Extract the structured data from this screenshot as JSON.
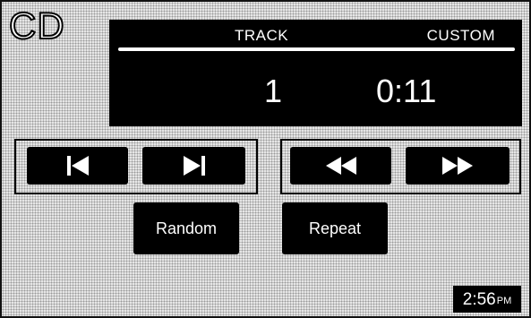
{
  "source": {
    "label": "CD"
  },
  "display": {
    "track_header": "TRACK",
    "mode_header": "CUSTOM",
    "track_number": "1",
    "elapsed_time": "0:11"
  },
  "controls": {
    "previous_track_icon": "skip-previous-icon",
    "next_track_icon": "skip-next-icon",
    "rewind_icon": "rewind-icon",
    "fast_forward_icon": "fast-forward-icon",
    "random_label": "Random",
    "repeat_label": "Repeat"
  },
  "clock": {
    "time": "2:56",
    "ampm": "PM"
  }
}
